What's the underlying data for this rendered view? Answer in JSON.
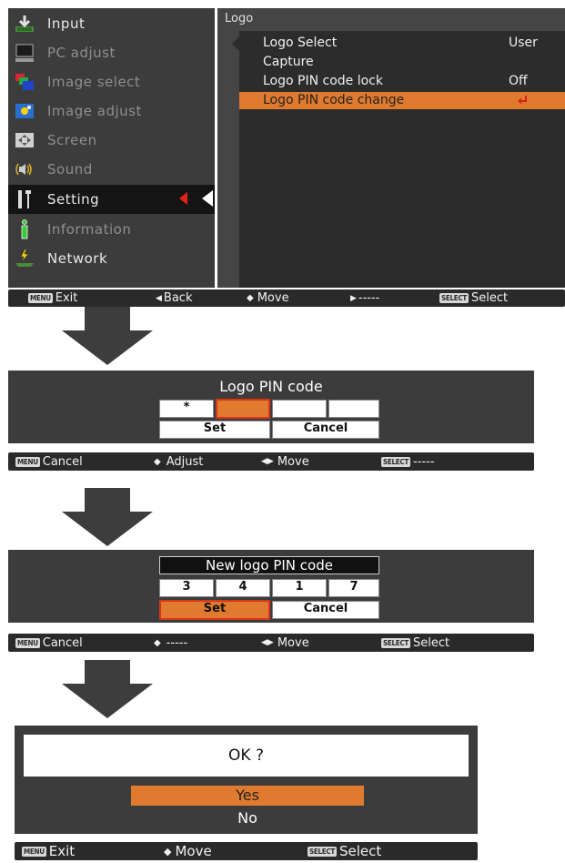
{
  "menu": {
    "items": [
      {
        "label": "Input",
        "icon": "input-icon",
        "active": true
      },
      {
        "label": "PC adjust",
        "icon": "pc-adjust-icon",
        "active": false
      },
      {
        "label": "Image select",
        "icon": "image-select-icon",
        "active": false
      },
      {
        "label": "Image adjust",
        "icon": "image-adjust-icon",
        "active": false
      },
      {
        "label": "Screen",
        "icon": "screen-icon",
        "active": false
      },
      {
        "label": "Sound",
        "icon": "sound-icon",
        "active": false
      },
      {
        "label": "Setting",
        "icon": "setting-icon",
        "active": true
      },
      {
        "label": "Information",
        "icon": "information-icon",
        "active": false
      },
      {
        "label": "Network",
        "icon": "network-icon",
        "active": true
      }
    ],
    "selected": "Setting"
  },
  "submenu": {
    "title": "Logo",
    "rows": [
      {
        "label": "Logo Select",
        "value": "User"
      },
      {
        "label": "Capture",
        "value": ""
      },
      {
        "label": "Logo PIN code lock",
        "value": "Off"
      },
      {
        "label": "Logo PIN code change",
        "value": ""
      }
    ],
    "highlighted": "Logo PIN code change"
  },
  "bar1": {
    "exit_key": "MENU",
    "exit": "Exit",
    "back": "Back",
    "move": "Move",
    "next": "-----",
    "select_key": "SELECT",
    "select": "Select"
  },
  "pin1": {
    "title": "Logo PIN code",
    "digits": [
      "*",
      "",
      "",
      ""
    ],
    "set": "Set",
    "cancel": "Cancel"
  },
  "bar2": {
    "cancel_key": "MENU",
    "cancel": "Cancel",
    "adjust": "Adjust",
    "move": "Move",
    "select_key": "SELECT",
    "select": "-----"
  },
  "pin2": {
    "title": "New logo PIN code",
    "digits": [
      "3",
      "4",
      "1",
      "7"
    ],
    "set": "Set",
    "cancel": "Cancel"
  },
  "bar3": {
    "cancel_key": "MENU",
    "cancel": "Cancel",
    "adjust": "-----",
    "move": "Move",
    "select_key": "SELECT",
    "select": "Select"
  },
  "ok": {
    "question": "OK ?",
    "yes": "Yes",
    "no": "No"
  },
  "bar4": {
    "exit_key": "MENU",
    "exit": "Exit",
    "move": "Move",
    "select_key": "SELECT",
    "select": "Select"
  },
  "colors": {
    "highlight": "#e07a2e",
    "panel": "#3c3c3c",
    "bar": "#2a2a2a",
    "red_marker": "#e0221a"
  }
}
